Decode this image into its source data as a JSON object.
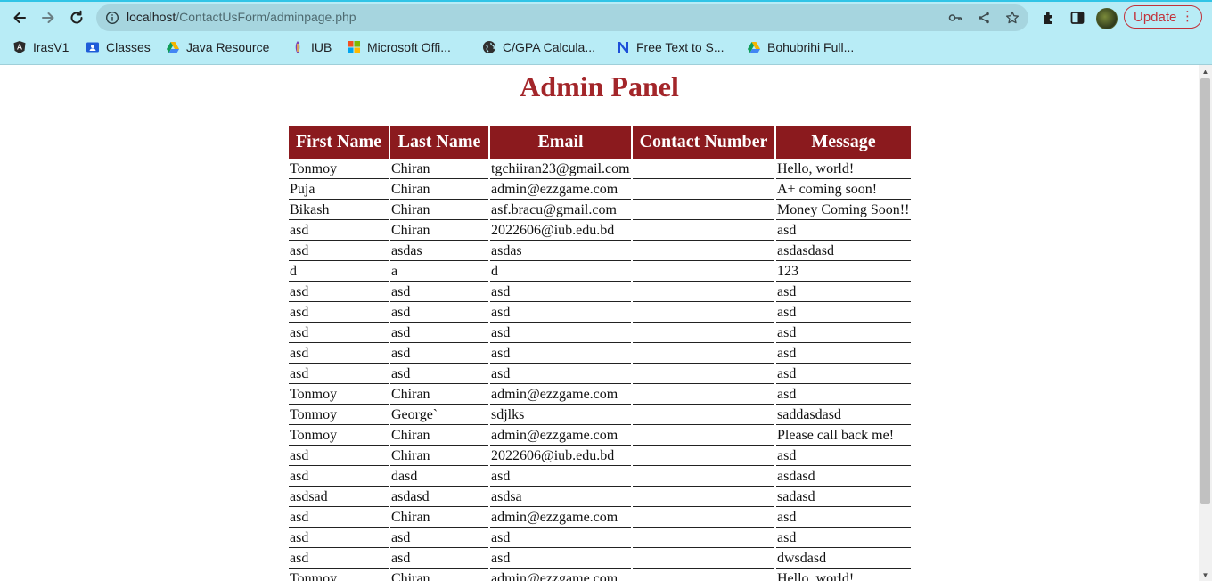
{
  "browser": {
    "url_host": "localhost",
    "url_path": "/ContactUsForm/adminpage.php",
    "update_label": "Update",
    "bookmarks": [
      {
        "label": "IrasV1",
        "icon": "angular-icon"
      },
      {
        "label": "Classes",
        "icon": "classroom-icon"
      },
      {
        "label": "Java Resource",
        "icon": "google-drive-icon"
      },
      {
        "label": "IUB",
        "icon": "iub-icon"
      },
      {
        "label": "Microsoft Offi...",
        "icon": "microsoft-icon"
      },
      {
        "label": "C/GPA Calcula...",
        "icon": "globe-icon"
      },
      {
        "label": "Free Text to S...",
        "icon": "n-icon"
      },
      {
        "label": "Bohubrihi Full...",
        "icon": "google-drive-icon"
      }
    ]
  },
  "page": {
    "title": "Admin Panel",
    "columns": [
      "First Name",
      "Last Name",
      "Email",
      "Contact Number",
      "Message"
    ],
    "rows": [
      [
        "Tonmoy",
        "Chiran",
        "tgchiiran23@gmail.com",
        "",
        "Hello, world!"
      ],
      [
        "Puja",
        "Chiran",
        "admin@ezzgame.com",
        "",
        "A+ coming soon!"
      ],
      [
        "Bikash",
        "Chiran",
        "asf.bracu@gmail.com",
        "",
        "Money Coming Soon!!"
      ],
      [
        "asd",
        "Chiran",
        "2022606@iub.edu.bd",
        "",
        "asd"
      ],
      [
        "asd",
        "asdas",
        "asdas",
        "",
        "asdasdasd"
      ],
      [
        "d",
        "a",
        "d",
        "",
        "123"
      ],
      [
        "asd",
        "asd",
        "asd",
        "",
        "asd"
      ],
      [
        "asd",
        "asd",
        "asd",
        "",
        "asd"
      ],
      [
        "asd",
        "asd",
        "asd",
        "",
        "asd"
      ],
      [
        "asd",
        "asd",
        "asd",
        "",
        "asd"
      ],
      [
        "asd",
        "asd",
        "asd",
        "",
        "asd"
      ],
      [
        "Tonmoy",
        "Chiran",
        "admin@ezzgame.com",
        "",
        "asd"
      ],
      [
        "Tonmoy",
        "George`",
        "sdjlks",
        "",
        "saddasdasd"
      ],
      [
        "Tonmoy",
        "Chiran",
        "admin@ezzgame.com",
        "",
        "Please call back me!"
      ],
      [
        "asd",
        "Chiran",
        "2022606@iub.edu.bd",
        "",
        "asd"
      ],
      [
        "asd",
        "dasd",
        "asd",
        "",
        "asdasd"
      ],
      [
        "asdsad",
        "asdasd",
        "asdsa",
        "",
        "sadasd"
      ],
      [
        "asd",
        "Chiran",
        "admin@ezzgame.com",
        "",
        "asd"
      ],
      [
        "asd",
        "asd",
        "asd",
        "",
        "asd"
      ],
      [
        "asd",
        "asd",
        "asd",
        "",
        "dwsdasd"
      ],
      [
        "Tonmoy",
        "Chiran",
        "admin@ezzgame.com",
        "",
        "Hello, world!"
      ]
    ]
  }
}
